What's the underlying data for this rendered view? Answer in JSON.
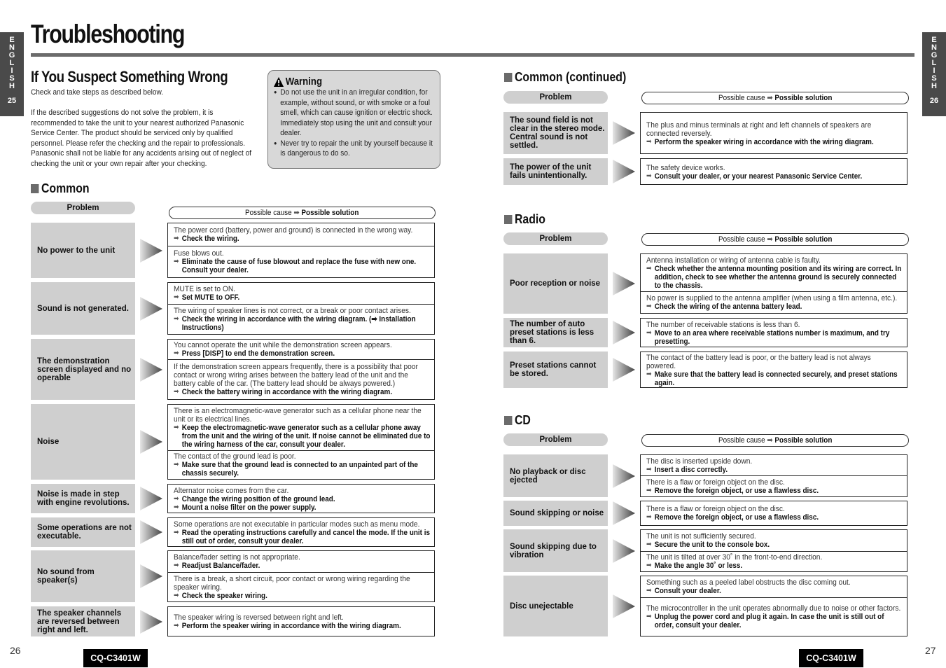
{
  "side_tabs": {
    "left": {
      "letters": [
        "E",
        "N",
        "G",
        "L",
        "I",
        "S",
        "H"
      ],
      "number": "25"
    },
    "right": {
      "letters": [
        "E",
        "N",
        "G",
        "L",
        "I",
        "S",
        "H"
      ],
      "number": "26"
    }
  },
  "title": "Troubleshooting",
  "intro": {
    "heading": "If You Suspect Something Wrong",
    "line1": "Check and take steps as described below.",
    "paragraph": "If the described suggestions do not solve the problem, it is recommended to take the unit to your nearest authorized Panasonic Service Center. The product should be serviced only by qualified personnel. Please refer the checking and the repair to professionals. Panasonic shall not be liable for any accidents arising out of neglect of checking the unit or your own repair after your checking."
  },
  "warning": {
    "title": "Warning",
    "icon": "warning-triangle-icon",
    "items": [
      "Do not use the unit in an irregular condition, for example, without sound, or with smoke or a foul smell, which can cause ignition or electric shock. Immediately stop using the unit and consult your dealer.",
      "Never try to repair the unit by yourself because it is dangerous to do so."
    ]
  },
  "headers": {
    "problem": "Problem",
    "cause": "Possible cause",
    "arrow": "➡",
    "solution": "Possible solution"
  },
  "sections": {
    "common": {
      "title": "Common",
      "rows": [
        {
          "problem": "No power to the unit",
          "entries": [
            {
              "cause": "The power cord (battery, power and ground) is connected in the wrong way.",
              "fixes": [
                "Check the wiring."
              ]
            },
            {
              "cause": "Fuse blows out.",
              "fixes": [
                "Eliminate the cause of fuse blowout and replace the fuse with new one. Consult your dealer."
              ]
            }
          ]
        },
        {
          "problem": "Sound is not generated.",
          "entries": [
            {
              "cause": "MUTE is set to ON.",
              "fixes": [
                "Set MUTE to OFF."
              ]
            },
            {
              "cause": "The wiring of speaker lines is not correct, or a break or poor contact arises.",
              "fixes": [
                "Check the wiring in accordance with the wiring diagram. (➡ Installation Instructions)"
              ]
            }
          ]
        },
        {
          "problem": "The demonstration screen displayed and no operable",
          "entries": [
            {
              "cause": "You cannot operate the unit while the demonstration screen appears.",
              "fixes": [
                "Press [DISP] to end the demonstration screen."
              ]
            },
            {
              "cause": "If the demonstration screen appears frequently, there is a possibility that poor contact or wrong wiring arises between the battery lead of the unit and the battery cable of the car. (The battery lead should be always powered.)",
              "fixes": [
                "Check the battery wiring in accordance with the wiring diagram."
              ]
            }
          ]
        },
        {
          "problem": "Noise",
          "entries": [
            {
              "cause": "There is an electromagnetic-wave generator such as a cellular phone near the unit or its electrical lines.",
              "fixes": [
                "Keep the electromagnetic-wave generator such as a cellular phone away from the unit and the wiring of the unit. If noise cannot be eliminated due to the wiring harness of the car, consult your dealer."
              ]
            },
            {
              "cause": "The contact of the ground lead is poor.",
              "fixes": [
                "Make sure that the ground lead is connected to an unpainted part of the chassis securely."
              ]
            }
          ]
        },
        {
          "problem": "Noise is made in step with engine revolutions.",
          "entries": [
            {
              "cause": "Alternator noise comes from the car.",
              "fixes": [
                "Change the wiring position of the ground lead.",
                "Mount a noise filter on the power supply."
              ]
            }
          ]
        },
        {
          "problem": "Some operations are not executable.",
          "entries": [
            {
              "cause": "Some operations are not executable in particular modes such as menu mode.",
              "fixes": [
                "Read the operating instructions carefully and cancel the mode. If the unit is still out of order, consult your dealer."
              ]
            }
          ]
        },
        {
          "problem": "No sound from speaker(s)",
          "entries": [
            {
              "cause": "Balance/fader setting is not appropriate.",
              "fixes": [
                "Readjust Balance/fader."
              ]
            },
            {
              "cause": "There is a break, a short circuit, poor contact or wrong wiring regarding the speaker wiring.",
              "fixes": [
                "Check the speaker wiring."
              ]
            }
          ]
        },
        {
          "problem": "The speaker channels are reversed between right and left.",
          "entries": [
            {
              "cause": "The speaker wiring is reversed between right and left.",
              "fixes": [
                "Perform the speaker wiring in accordance with the wiring diagram."
              ]
            }
          ]
        }
      ]
    },
    "common_continued": {
      "title": "Common (continued)",
      "rows": [
        {
          "problem": "The sound field is not clear in the stereo mode. Central sound is not settled.",
          "entries": [
            {
              "cause": "The plus and minus terminals at right and left channels of speakers are connected reversely.",
              "fixes": [
                "Perform the speaker wiring in accordance with the wiring diagram."
              ]
            }
          ]
        },
        {
          "problem": "The power of the unit fails unintentionally.",
          "entries": [
            {
              "cause": "The safety device works.",
              "fixes": [
                "Consult your dealer, or your nearest Panasonic Service Center."
              ]
            }
          ]
        }
      ]
    },
    "radio": {
      "title": "Radio",
      "rows": [
        {
          "problem": "Poor reception or noise",
          "entries": [
            {
              "cause": "Antenna installation or wiring of antenna cable is faulty.",
              "fixes": [
                "Check whether the antenna mounting position and its wiring are correct. In addition, check to see whether the antenna ground is securely connected to the chassis."
              ]
            },
            {
              "cause": "No power is supplied to the antenna amplifier (when using a film antenna, etc.).",
              "fixes": [
                "Check the wiring of the antenna battery lead."
              ]
            }
          ]
        },
        {
          "problem": "The number of auto preset stations is less than 6.",
          "entries": [
            {
              "cause": "The number of receivable stations is less than 6.",
              "fixes": [
                "Move to an area where receivable stations number is maximum, and try presetting."
              ]
            }
          ]
        },
        {
          "problem": "Preset stations cannot be stored.",
          "entries": [
            {
              "cause": "The contact of the battery lead is poor, or the battery lead is not always powered.",
              "fixes": [
                "Make sure that the battery lead is connected securely, and preset stations again."
              ]
            }
          ]
        }
      ]
    },
    "cd": {
      "title": "CD",
      "rows": [
        {
          "problem": "No playback or disc ejected",
          "entries": [
            {
              "cause": "The disc is inserted upside down.",
              "fixes": [
                "Insert a disc correctly."
              ]
            },
            {
              "cause": "There is a flaw or foreign object on the disc.",
              "fixes": [
                "Remove the foreign object, or use a flawless disc."
              ]
            }
          ]
        },
        {
          "problem": "Sound skipping or noise",
          "entries": [
            {
              "cause": "There is a flaw or foreign object on the disc.",
              "fixes": [
                "Remove the foreign object, or use a flawless disc."
              ]
            }
          ]
        },
        {
          "problem": "Sound skipping due to vibration",
          "entries": [
            {
              "cause": "The unit is not sufficiently secured.",
              "fixes": [
                "Secure the unit to the console box."
              ]
            },
            {
              "cause": "The unit is tilted at over 30˚ in the front-to-end direction.",
              "fixes": [
                "Make the angle 30˚ or less."
              ]
            }
          ]
        },
        {
          "problem": "Disc unejectable",
          "entries": [
            {
              "cause": "Something such as a peeled label obstructs the disc coming out.",
              "fixes": [
                "Consult your dealer."
              ]
            },
            {
              "cause": "The microcontroller in the unit operates abnormally due to noise or other factors.",
              "fixes": [
                "Unplug the power cord and plug it again. In case the unit is still out of order, consult your dealer."
              ]
            }
          ]
        }
      ]
    }
  },
  "footer": {
    "left_page": "26",
    "right_page": "27",
    "model": "CQ-C3401W"
  }
}
